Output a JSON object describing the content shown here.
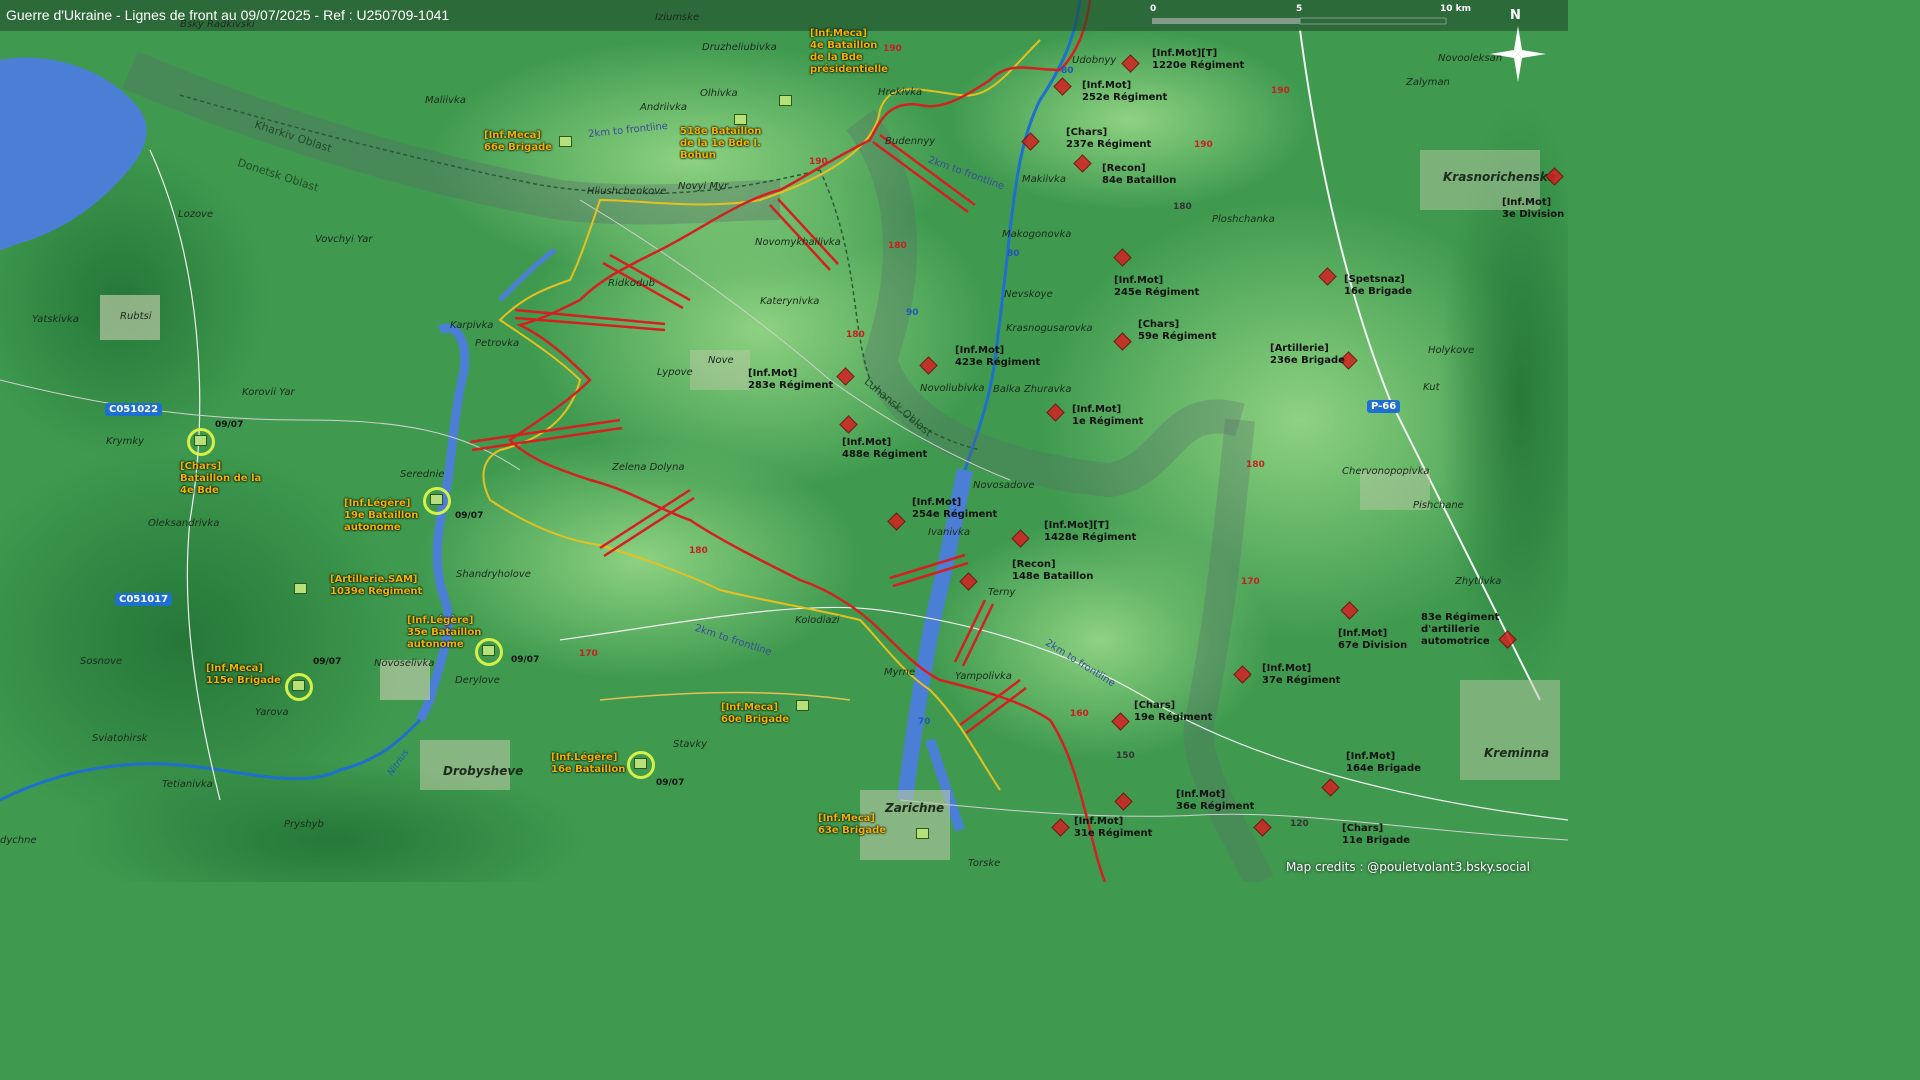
{
  "title": "Guerre d'Ukraine - Lignes de front au 09/07/2025 - Ref : U250709-1041",
  "scale": {
    "zero": "0",
    "mid": "5",
    "end": "10 km"
  },
  "north_label": "N",
  "credits": "Map credits : @pouletvolant3.bsky.social",
  "colors": {
    "russian_line": "#d42020",
    "ukrainian_line": "#e6c020",
    "water": "#4b7fd6",
    "terrain": "#3f9a4f"
  },
  "icons": {
    "compass": "compass-rose-icon",
    "russian_unit": "red-diamond-icon",
    "ukrainian_unit": "green-square-icon",
    "attack": "red-double-arrow-icon"
  },
  "places": {
    "izium": "Iziumske",
    "radkivski": "Bsky Radkivski",
    "druzheliubivka": "Druzheliubivka",
    "maliivka": "Maliivka",
    "andriivka": "Andriivka",
    "olhivka": "Olhivka",
    "hrekivka": "Hrekivka",
    "udobnyy": "Udobnyy",
    "budennyy": "Budennyy",
    "makiivka": "Makiivka",
    "hliushchenkove": "Hliushchenkove",
    "novyi_myr": "Novyi Myr",
    "lozove": "Lozove",
    "vovchyi_yar": "Vovchyi Yar",
    "novomykhailivka": "Novomykhailivka",
    "makogonovka": "Makogonovka",
    "ploshchanka": "Ploshchanka",
    "ridkodub": "Ridkodub",
    "katerynivka": "Katerynivka",
    "nevskoye": "Nevskoye",
    "krasnogusarovka": "Krasnogusarovka",
    "yatskivka": "Yatskivka",
    "rubtsi": "Rubtsi",
    "karpivka": "Karpivka",
    "petrovka": "Petrovka",
    "nove": "Nove",
    "lypove": "Lypove",
    "novoliubivka": "Novoliubivka",
    "balka": "Balka Zhuravka",
    "korovii_yar": "Korovii Yar",
    "krymky": "Krymky",
    "zelena_dolyna": "Zelena Dolyna",
    "serednie": "Serednie",
    "novosadove": "Novosadove",
    "ivanivka": "Ivanivka",
    "oleksandrivka": "Oleksandrivka",
    "terny": "Terny",
    "shandryholove": "Shandryholove",
    "kolodiazi": "Kolodiazi",
    "myrne": "Myrne",
    "yampolivka": "Yampolivka",
    "sosnove": "Sosnove",
    "novoselivka": "Novoselivka",
    "derylove": "Derylove",
    "yarova": "Yarova",
    "stavky": "Stavky",
    "sviatohirsk": "Sviatohirsk",
    "tetianivka": "Tetianivka",
    "drobysheve": "Drobysheve",
    "zarichne": "Zarichne",
    "pryshyb": "Pryshyb",
    "dychne": "dychne",
    "torske": "Torske",
    "krasnorichenske": "Krasnorichenske",
    "novoolekse": "Novooleksan",
    "zalyman": "Zalyman",
    "holykove": "Holykove",
    "kut": "Kut",
    "chervonopopivka": "Chervonopopivka",
    "pishchane": "Pishchane",
    "zhytlivka": "Zhytlivka",
    "kreminna": "Kreminna"
  },
  "oblasts": {
    "kharkiv": "Kharkiv Oblast",
    "donetsk": "Donetsk Oblast",
    "luhansk": "Luhansk Oblast"
  },
  "frontline_labels": [
    "2km to frontline",
    "2km to frontline",
    "2km to frontline",
    "2km to frontline"
  ],
  "shields": {
    "c051022": "C051022",
    "c051017": "C051017",
    "p66": "P-66"
  },
  "road_numbers": [
    "190",
    "190",
    "190",
    "190",
    "180",
    "180",
    "180",
    "180",
    "170",
    "170",
    "160"
  ],
  "route_numbers": [
    "80",
    "80",
    "90",
    "70",
    "180",
    "150",
    "120"
  ],
  "river": "Nitrius",
  "russian_units": [
    {
      "l1": "[Inf.Mot][T]",
      "l2": "1220e Régiment"
    },
    {
      "l1": "[Inf.Mot]",
      "l2": "252e Régiment"
    },
    {
      "l1": "[Chars]",
      "l2": "237e Régiment"
    },
    {
      "l1": "[Recon]",
      "l2": "84e Bataillon"
    },
    {
      "l1": "[Inf.Mot]",
      "l2": "245e Régiment"
    },
    {
      "l1": "[Spetsnaz]",
      "l2": "16e Brigade"
    },
    {
      "l1": "[Chars]",
      "l2": "59e Régiment"
    },
    {
      "l1": "[Inf.Mot]",
      "l2": "423e Régiment"
    },
    {
      "l1": "[Artillerie]",
      "l2": "236e Brigade"
    },
    {
      "l1": "[Inf.Mot]",
      "l2": "283e Régiment"
    },
    {
      "l1": "[Inf.Mot]",
      "l2": "1e Régiment"
    },
    {
      "l1": "[Inf.Mot]",
      "l2": "488e Régiment"
    },
    {
      "l1": "[Inf.Mot]",
      "l2": "254e Régiment"
    },
    {
      "l1": "[Inf.Mot][T]",
      "l2": "1428e Régiment"
    },
    {
      "l1": "[Recon]",
      "l2": "148e Bataillon"
    },
    {
      "l1": "[Inf.Mot]",
      "l2": "67e Division"
    },
    {
      "l1": "83e Régiment",
      "l2": "d'artillerie",
      "l3": "automotrice"
    },
    {
      "l1": "[Inf.Mot]",
      "l2": "37e Régiment"
    },
    {
      "l1": "[Chars]",
      "l2": "19e Régiment"
    },
    {
      "l1": "[Inf.Mot]",
      "l2": "164e Brigade"
    },
    {
      "l1": "[Inf.Mot]",
      "l2": "36e Régiment"
    },
    {
      "l1": "[Inf.Mot]",
      "l2": "31e Régiment"
    },
    {
      "l1": "[Chars]",
      "l2": "11e Brigade"
    },
    {
      "l1": "[Inf.Mot]",
      "l2": "3e Division"
    }
  ],
  "ukrainian_units": [
    {
      "l1": "[Inf.Meca]",
      "l2": "4e Bataillon",
      "l3": "de la Bde",
      "l4": "présidentielle"
    },
    {
      "l1": "[Inf.Meca]",
      "l2": "66e Brigade"
    },
    {
      "l1": "518e Bataillon",
      "l2": "de la 1e Bde I.",
      "l3": "Bohun"
    },
    {
      "l1": "[Chars]",
      "l2": "Bataillon de la",
      "l3": "4e Bde"
    },
    {
      "l1": "[Inf.Légère]",
      "l2": "19e Bataillon",
      "l3": "autonome"
    },
    {
      "l1": "[Artillerie.SAM]",
      "l2": "1039e Régiment"
    },
    {
      "l1": "[Inf.Légère]",
      "l2": "35e Bataillon",
      "l3": "autonome"
    },
    {
      "l1": "[Inf.Meca]",
      "l2": "115e Brigade"
    },
    {
      "l1": "[Inf.Meca]",
      "l2": "60e Brigade"
    },
    {
      "l1": "[Inf.Légère]",
      "l2": "16e Bataillon"
    },
    {
      "l1": "[Inf.Meca]",
      "l2": "63e Brigade"
    }
  ],
  "unit_dates": [
    "09/07",
    "09/07",
    "09/07",
    "09/07",
    "09/07"
  ]
}
